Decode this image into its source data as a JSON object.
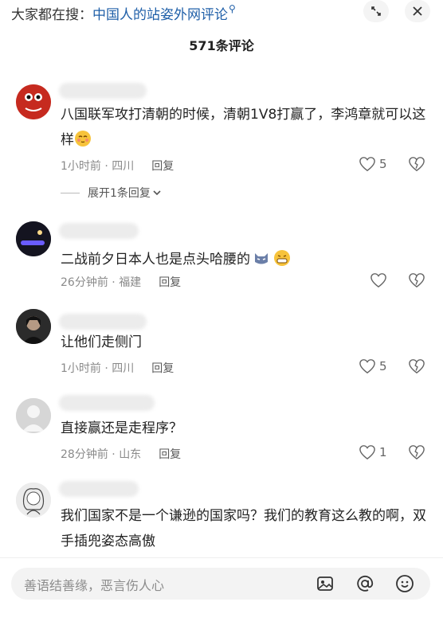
{
  "search": {
    "prefix": "大家都在搜：",
    "query": "中国人的站姿外网评论"
  },
  "header": {
    "title": "571条评论"
  },
  "comments": [
    {
      "text": "八国联军攻打清朝的时候，清朝1V8打赢了，李鸿章就可以这样",
      "time": "1小时前",
      "location": "四川",
      "reply_label": "回复",
      "likes": "5",
      "replies_toggle": "展开1条回复"
    },
    {
      "text": "二战前夕日本人也是点头哈腰的",
      "time": "26分钟前",
      "location": "福建",
      "reply_label": "回复",
      "likes": ""
    },
    {
      "text": "让他们走侧门",
      "time": "1小时前",
      "location": "四川",
      "reply_label": "回复",
      "likes": "5"
    },
    {
      "text": "直接赢还是走程序？",
      "time": "28分钟前",
      "location": "山东",
      "reply_label": "回复",
      "likes": "1"
    },
    {
      "text": "我们国家不是一个谦逊的国家吗？我们的教育这么教的啊，双手插兜姿态高傲",
      "time": "",
      "location": "",
      "reply_label": "",
      "likes": ""
    }
  ],
  "input": {
    "placeholder": "善语结善缘，恶言伤人心"
  },
  "icons": {
    "search": "magnifier-icon",
    "minimize": "minimize-icon",
    "close": "close-icon",
    "like": "heart-icon",
    "dislike": "broken-heart-icon",
    "chevron": "chevron-down-icon",
    "image": "image-icon",
    "mention": "at-icon",
    "emoji": "smiley-icon"
  }
}
